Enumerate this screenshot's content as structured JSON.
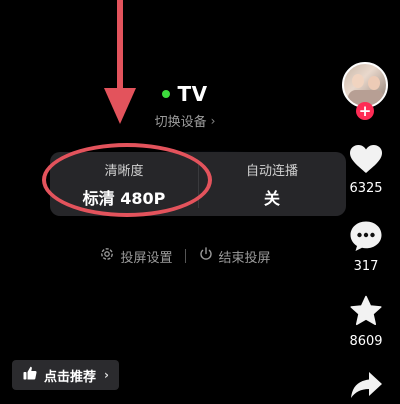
{
  "cast": {
    "device_name": "TV",
    "status_color": "#3ddc3d",
    "switch_device_label": "切换设备",
    "switch_chevron": "›"
  },
  "settings": {
    "resolution_label": "清晰度",
    "resolution_value": "标清 480P",
    "autoplay_label": "自动连播",
    "autoplay_value": "关"
  },
  "actions": {
    "cast_settings_label": "投屏设置",
    "end_cast_label": "结束投屏"
  },
  "recommend": {
    "label": "点击推荐",
    "chevron": "›"
  },
  "sidebar": {
    "like_count": "6325",
    "comment_count": "317",
    "favorite_count": "8609",
    "follow_symbol": "+"
  },
  "colors": {
    "annotation": "#e3535c",
    "follow_badge": "#fe2c55",
    "card_bg": "#262629"
  },
  "icons": [
    "gear-icon",
    "power-icon",
    "thumbs-up-icon",
    "heart-icon",
    "comment-icon",
    "star-icon",
    "share-icon"
  ]
}
